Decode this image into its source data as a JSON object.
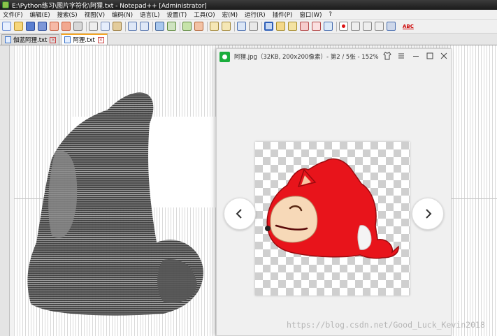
{
  "window": {
    "title": "E:\\Python练习\\图片字符化\\阿狸.txt - Notepad++ [Administrator]"
  },
  "menu": [
    "文件(F)",
    "编辑(E)",
    "搜索(S)",
    "视图(V)",
    "编码(N)",
    "语言(L)",
    "设置(T)",
    "工具(O)",
    "宏(M)",
    "运行(R)",
    "插件(P)",
    "窗口(W)",
    "?"
  ],
  "toolbar": {
    "spellcheck_label": "ABC",
    "icons": [
      "new-file-icon",
      "open-file-icon",
      "save-icon",
      "save-all-icon",
      "close-icon",
      "close-all-icon",
      "print-icon",
      "cut-icon",
      "copy-icon",
      "paste-icon",
      "undo-icon",
      "redo-icon",
      "find-icon",
      "replace-icon",
      "zoom-in-icon",
      "zoom-out-icon",
      "sync-v-icon",
      "sync-h-icon",
      "wrap-icon",
      "all-chars-icon",
      "indent-guide-icon",
      "user-lang-icon",
      "doc-map-icon",
      "function-list-icon",
      "folder-workspace-icon",
      "monitor-icon",
      "record-macro-icon",
      "stop-macro-icon",
      "play-macro-icon",
      "run-macro-multiple-icon",
      "save-macro-icon"
    ]
  },
  "tabs": [
    {
      "label": "伽蓝阿狸.txt",
      "active": false
    },
    {
      "label": "阿狸.txt",
      "active": true
    }
  ],
  "viewer": {
    "title": "阿狸.jpg（32KB, 200x200像素）- 第2 / 5张 - 152%",
    "prev_label": "‹",
    "next_label": "›"
  },
  "watermark": "https://blog.csdn.net/Good_Luck_Kevin2018",
  "colors": {
    "accent_tab": "#f5a623",
    "viewer_logo": "#1aad3c",
    "character_red": "#e8141b"
  }
}
